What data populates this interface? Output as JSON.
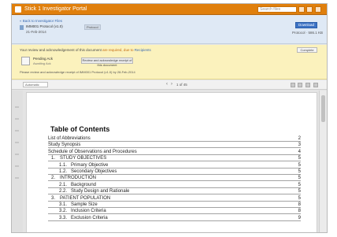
{
  "window": {
    "title": "Stick 1 Investigator Portal",
    "search_placeholder": "Search files",
    "accent_color": "#e07f0c"
  },
  "doc_info": {
    "back_link": "« Back to Investigator Files",
    "title": "IMM001 Protocol (v1.0)",
    "tag": "Protocol",
    "subtitle": "21-Feb-2014",
    "download_label": "Download",
    "file_size": "Protocol · 586.1 KB"
  },
  "notice": {
    "line1_prefix": "Your review and acknowledgement of this document",
    "line1_highlight": "are required, due to",
    "line1_link": "Recipients",
    "right_button": "Complete",
    "card_title": "Pending Ack",
    "card_subtitle": "Awaiting Ack",
    "card_button": "Review and acknowledge receipt of this document",
    "line2": "Please review and acknowledge receipt of IMM001 Protocol (v1.0) by 28-Feb-2014"
  },
  "toolbar": {
    "zoom_value": "Automatic",
    "page_indicator": "1 of 45"
  },
  "toc": {
    "heading": "Table of Contents",
    "rows": [
      {
        "num": "",
        "text": "List of Abbreviations",
        "page": "2",
        "level": 0
      },
      {
        "num": "",
        "text": "Study Synopsis",
        "page": "3",
        "level": 0
      },
      {
        "num": "",
        "text": "Schedule of Observations and Procedures",
        "page": "4",
        "level": 0
      },
      {
        "num": "1.",
        "text": "STUDY OBJECTIVES",
        "page": "5",
        "level": 0
      },
      {
        "num": "1.1.",
        "text": "Primary Objective",
        "page": "5",
        "level": 1
      },
      {
        "num": "1.2.",
        "text": "Secondary Objectives",
        "page": "5",
        "level": 1
      },
      {
        "num": "2.",
        "text": "INTRODUCTION",
        "page": "5",
        "level": 0
      },
      {
        "num": "2.1.",
        "text": "Background",
        "page": "5",
        "level": 1
      },
      {
        "num": "2.2.",
        "text": "Study Design and Rationale",
        "page": "5",
        "level": 1
      },
      {
        "num": "3.",
        "text": "PATIENT POPULATION",
        "page": "5",
        "level": 0
      },
      {
        "num": "3.1.",
        "text": "Sample Size",
        "page": "8",
        "level": 1
      },
      {
        "num": "3.2.",
        "text": "Inclusion Criteria",
        "page": "8",
        "level": 1
      },
      {
        "num": "3.3.",
        "text": "Exclusion Criteria",
        "page": "9",
        "level": 1
      }
    ]
  }
}
